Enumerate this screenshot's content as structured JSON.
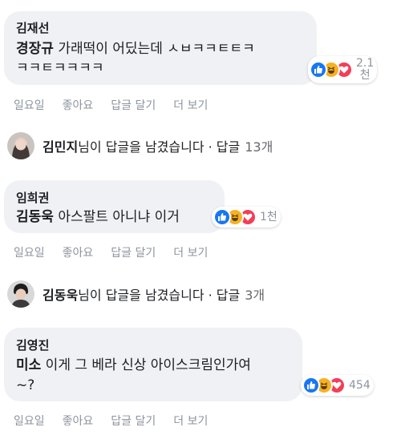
{
  "comments": [
    {
      "author": "김재선",
      "mention": "경장규",
      "text": " 가래떡이 어딨는데 ㅅㅂㅋㅋㅌㅌㅋ",
      "text2": "ㅋㅋㅌㅋㅋㅋㅋ",
      "reaction_count": "2.1",
      "reaction_count2": "천",
      "actions": [
        "일요일",
        "좋아요",
        "답글 달기",
        "더 보기"
      ]
    },
    {
      "author": "임희권",
      "mention": "김동욱",
      "text": " 아스팔트 아니냐 이거",
      "reaction_count": "1천",
      "actions": [
        "일요일",
        "좋아요",
        "답글 달기",
        "더 보기"
      ]
    },
    {
      "author": "김영진",
      "mention": "미소",
      "text": " 이게 그 베라 신상 아이스크림인가여",
      "text2": "~?",
      "reaction_count": "454",
      "actions": [
        "일요일",
        "좋아요",
        "답글 달기",
        "더 보기"
      ]
    }
  ],
  "replies": [
    {
      "name": "김민지",
      "suffix": "님이 답글을 남겼습니다 · 답글",
      "count": "13개"
    },
    {
      "name": "김동욱",
      "suffix": "님이 답글을 남겼습니다 · 답글",
      "count": "3개"
    }
  ],
  "reaction_icons": [
    "like-icon",
    "haha-icon",
    "love-icon"
  ],
  "colors": {
    "bubble": "#f0f1f4",
    "like": "#1877f2",
    "haha": "#f7b125",
    "love": "#f33e58",
    "meta": "#8d949e"
  }
}
